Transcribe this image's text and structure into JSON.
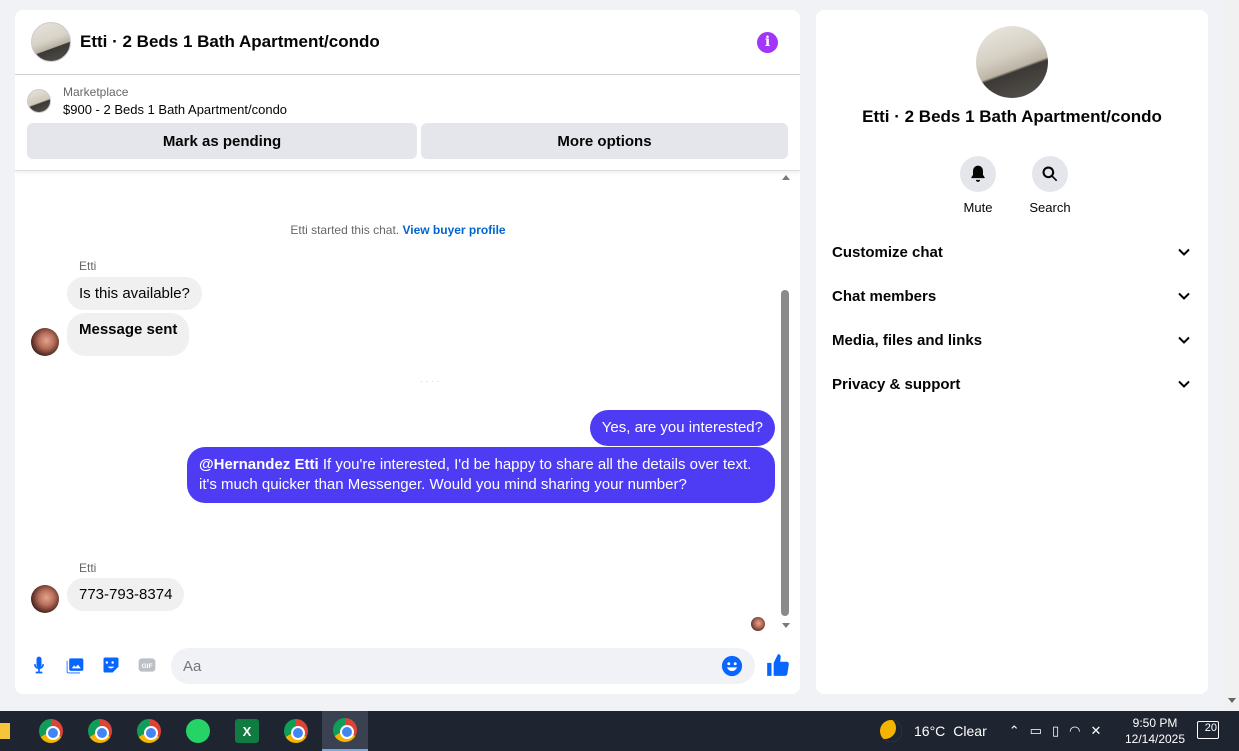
{
  "chat": {
    "title": "Etti · 2 Beds 1 Bath Apartment/condo",
    "marketplace_label": "Marketplace",
    "listing": "$900 - 2 Beds 1 Bath Apartment/condo",
    "mark_pending": "Mark as pending",
    "more_options": "More options",
    "system_text": "Etti started this chat.",
    "view_profile": "View buyer profile",
    "messages": [
      {
        "sender": "Etti",
        "text": "Is this available?"
      },
      {
        "text": "Message sent"
      },
      {
        "text": "Yes, are you interested?"
      },
      {
        "mention": "@Hernandez Etti",
        "text": " If you're interested, I'd be happy to share all the details over text. it's much quicker than Messenger. Would you mind sharing your number?"
      },
      {
        "sender": "Etti",
        "text": "773-793-8374"
      }
    ],
    "input_placeholder": "Aa"
  },
  "details": {
    "title": "Etti · 2 Beds 1 Bath Apartment/condo",
    "mute_label": "Mute",
    "search_label": "Search",
    "sections": [
      "Customize chat",
      "Chat members",
      "Media, files and links",
      "Privacy & support"
    ]
  },
  "taskbar": {
    "weather_temp": "16°C",
    "weather_desc": "Clear",
    "time": "9:50 PM",
    "date": "12/14/2025",
    "notification_count": "20",
    "excel_letter": "X"
  },
  "colors": {
    "accent": "#0866ff",
    "outgoing_bubble": "#4e3cf5",
    "info": "#a334fa"
  }
}
